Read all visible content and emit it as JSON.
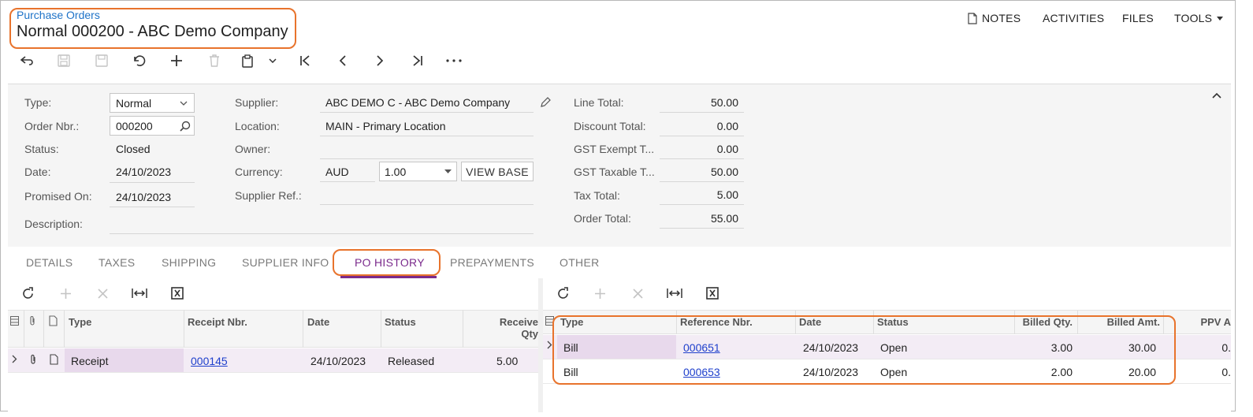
{
  "header": {
    "breadcrumb": "Purchase Orders",
    "title": "Normal 000200 - ABC Demo Company"
  },
  "topmenu": {
    "notes": "NOTES",
    "activities": "ACTIVITIES",
    "files": "FILES",
    "tools": "TOOLS"
  },
  "summary": {
    "type_label": "Type:",
    "type_value": "Normal",
    "order_nbr_label": "Order Nbr.:",
    "order_nbr_value": "000200",
    "status_label": "Status:",
    "status_value": "Closed",
    "date_label": "Date:",
    "date_value": "24/10/2023",
    "promised_label": "Promised On:",
    "promised_value": "24/10/2023",
    "description_label": "Description:",
    "description_value": "",
    "supplier_label": "Supplier:",
    "supplier_value": "ABC DEMO C - ABC Demo Company",
    "location_label": "Location:",
    "location_value": "MAIN - Primary Location",
    "owner_label": "Owner:",
    "owner_value": "",
    "currency_label": "Currency:",
    "currency_value": "AUD",
    "currency_rate": "1.00",
    "view_base": "VIEW BASE",
    "supplier_ref_label": "Supplier Ref.:",
    "supplier_ref_value": "",
    "line_total_label": "Line Total:",
    "line_total_value": "50.00",
    "discount_total_label": "Discount Total:",
    "discount_total_value": "0.00",
    "gst_exempt_label": "GST Exempt T...",
    "gst_exempt_value": "0.00",
    "gst_taxable_label": "GST Taxable T...",
    "gst_taxable_value": "50.00",
    "tax_total_label": "Tax Total:",
    "tax_total_value": "5.00",
    "order_total_label": "Order Total:",
    "order_total_value": "55.00"
  },
  "tabs": [
    "DETAILS",
    "TAXES",
    "SHIPPING",
    "SUPPLIER INFO",
    "PO HISTORY",
    "PREPAYMENTS",
    "OTHER"
  ],
  "receipts": {
    "columns": {
      "type": "Type",
      "receipt_nbr": "Receipt Nbr.",
      "date": "Date",
      "status": "Status",
      "received_line1": "Receive",
      "received_line2": "Qty"
    },
    "rows": [
      {
        "type": "Receipt",
        "receipt_nbr": "000145",
        "date": "24/10/2023",
        "status": "Released",
        "received_qty": "5.00"
      }
    ]
  },
  "bills": {
    "columns": {
      "type": "Type",
      "reference_nbr": "Reference Nbr.",
      "date": "Date",
      "status": "Status",
      "billed_qty": "Billed Qty.",
      "billed_amt": "Billed Amt.",
      "ppv": "PPV A"
    },
    "rows": [
      {
        "type": "Bill",
        "reference_nbr": "000651",
        "date": "24/10/2023",
        "status": "Open",
        "billed_qty": "3.00",
        "billed_amt": "30.00",
        "ppv": "0."
      },
      {
        "type": "Bill",
        "reference_nbr": "000653",
        "date": "24/10/2023",
        "status": "Open",
        "billed_qty": "2.00",
        "billed_amt": "20.00",
        "ppv": "0."
      }
    ]
  },
  "colors": {
    "accent": "#7a2a8c",
    "highlight": "#e8732c",
    "link": "#1e3fcc"
  }
}
